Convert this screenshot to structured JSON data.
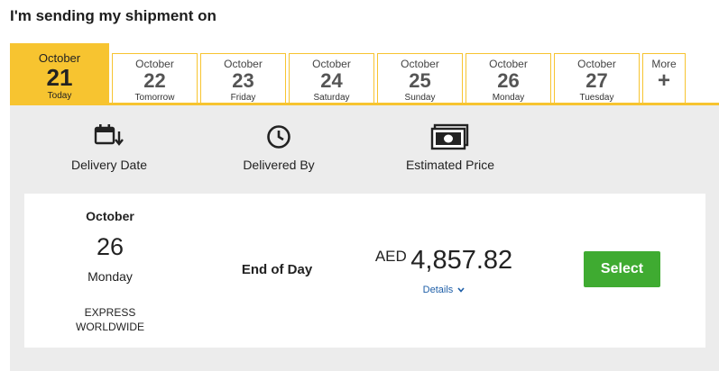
{
  "heading": "I'm sending my shipment on",
  "tabs": [
    {
      "month": "October",
      "day": "21",
      "dow": "Today",
      "active": true
    },
    {
      "month": "October",
      "day": "22",
      "dow": "Tomorrow"
    },
    {
      "month": "October",
      "day": "23",
      "dow": "Friday"
    },
    {
      "month": "October",
      "day": "24",
      "dow": "Saturday"
    },
    {
      "month": "October",
      "day": "25",
      "dow": "Sunday"
    },
    {
      "month": "October",
      "day": "26",
      "dow": "Monday"
    },
    {
      "month": "October",
      "day": "27",
      "dow": "Tuesday"
    }
  ],
  "more_tab": {
    "label": "More",
    "icon": "plus-icon",
    "symbol": "+"
  },
  "columns": {
    "delivery_date": {
      "label": "Delivery Date",
      "icon": "calendar-down-icon"
    },
    "delivered_by": {
      "label": "Delivered By",
      "icon": "clock-icon"
    },
    "estimated_price": {
      "label": "Estimated Price",
      "icon": "banknote-icon"
    }
  },
  "option": {
    "month": "October",
    "day": "26",
    "dow": "Monday",
    "service_line1": "EXPRESS",
    "service_line2": "WORLDWIDE",
    "delivered_by": "End of Day",
    "currency": "AED",
    "amount": "4,857.82",
    "details_label": "Details",
    "select_label": "Select"
  },
  "colors": {
    "accent": "#f7c430",
    "select": "#3fab31",
    "link": "#1f5fa8",
    "panel": "#ececec"
  }
}
